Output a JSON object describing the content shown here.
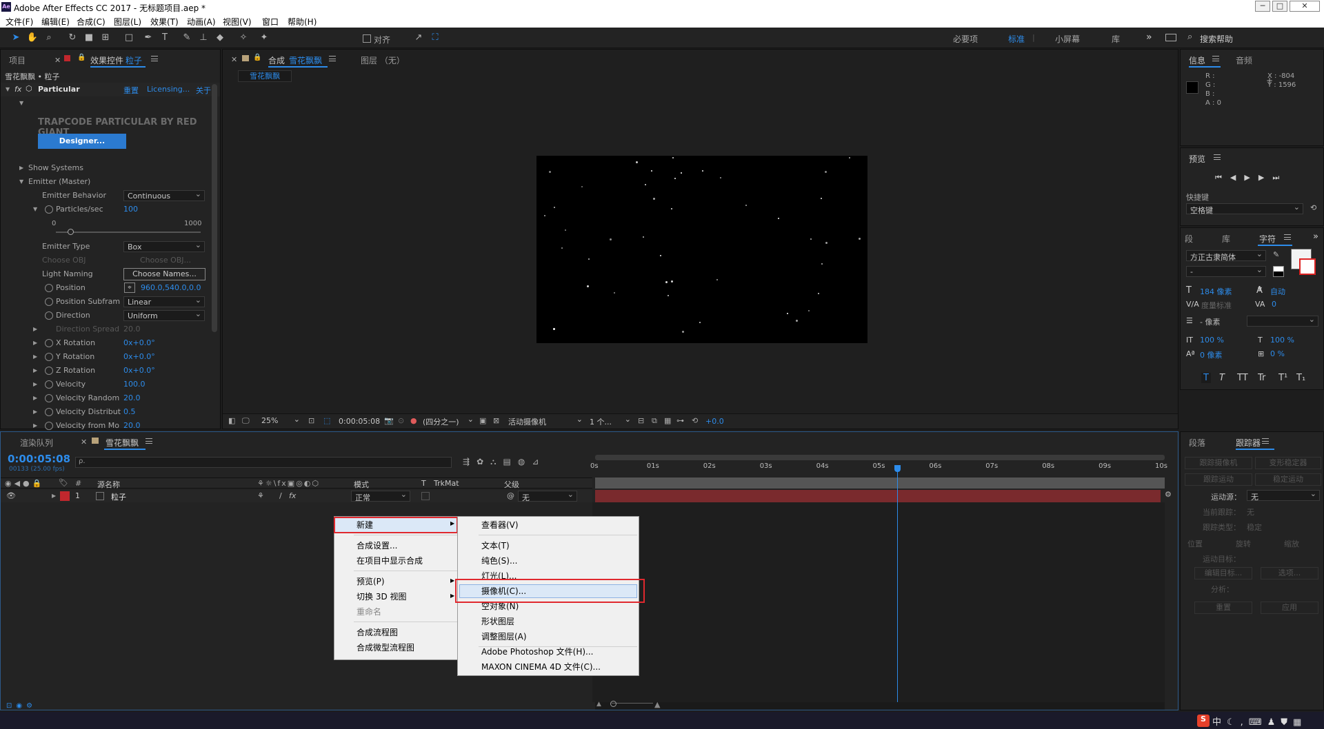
{
  "window": {
    "app_icon": "Ae",
    "title": "Adobe After Effects CC 2017 - 无标题项目.aep *",
    "controls": [
      "─",
      "□",
      "✕"
    ]
  },
  "menubar": [
    "文件(F)",
    "编辑(E)",
    "合成(C)",
    "图层(L)",
    "效果(T)",
    "动画(A)",
    "视图(V)",
    "窗口",
    "帮助(H)"
  ],
  "toolbar": {
    "align_label": "对齐",
    "workspaces": [
      "必要项",
      "标准",
      "小屏幕",
      "库"
    ],
    "active_workspace": "标准",
    "search_placeholder": "搜索帮助"
  },
  "left_panel": {
    "tabs": {
      "project": "项目",
      "effect_controls_prefix": "效果控件",
      "effect_layer": "粒子"
    },
    "breadcrumb": "雪花飘飘 • 粒子",
    "effect_name": "Particular",
    "reset": "重置",
    "licensing": "Licensing...",
    "about": "关于",
    "banner": "TRAPCODE PARTICULAR BY RED GIANT",
    "designer_btn": "Designer...",
    "show_systems": "Show Systems",
    "emitter": "Emitter (Master)",
    "emitter_behavior_label": "Emitter Behavior",
    "emitter_behavior": "Continuous",
    "particles_label": "Particles/sec",
    "particles_value": "100",
    "slider_min": "0",
    "slider_max": "1000",
    "slider_value": 100,
    "emitter_type_label": "Emitter Type",
    "emitter_type": "Box",
    "choose_obj_label": "Choose OBJ",
    "choose_obj_btn": "Choose OBJ...",
    "light_naming_label": "Light Naming",
    "choose_names_btn": "Choose Names...",
    "position_label": "Position",
    "position_value": "960.0,540.0,0.0",
    "position_subframe_label": "Position Subfram",
    "position_subframe": "Linear",
    "direction_label": "Direction",
    "direction": "Uniform",
    "direction_spread_label": "Direction Spread",
    "direction_spread": "20.0",
    "xrot_label": "X Rotation",
    "xrot": "0x+0.0°",
    "yrot_label": "Y Rotation",
    "yrot": "0x+0.0°",
    "zrot_label": "Z Rotation",
    "zrot": "0x+0.0°",
    "velocity_label": "Velocity",
    "velocity": "100.0",
    "vrand_label": "Velocity Random",
    "vrand": "20.0",
    "vdist_label": "Velocity Distribut",
    "vdist": "0.5",
    "vfrom_label": "Velocity from Mo",
    "vfrom": "20.0"
  },
  "comp_panel": {
    "tab_prefix": "合成",
    "comp_name": "雪花飘飘",
    "layer_tab": "图层 （无）",
    "subtab": "雪花飘飘",
    "zoom": "25%",
    "timecode": "0:00:05:08",
    "resolution": "(四分之一)",
    "camera": "活动摄像机",
    "views": "1 个...",
    "exposure": "+0.0"
  },
  "right_panel": {
    "info_tab": "信息",
    "audio_tab": "音频",
    "rgba": [
      "R :",
      "G :",
      "B :",
      "A : 0"
    ],
    "xy": [
      "X : -804",
      "Y : 1596"
    ],
    "preview_tab": "预览",
    "shortcut_label": "快捷键",
    "shortcut_value": "空格键",
    "para_tab": "段",
    "lib_tab": "库",
    "char_tab": "字符",
    "font": "方正古隶简体",
    "style": "-",
    "size": "184 像素",
    "leading": "自动",
    "tracking_label": "度量标准",
    "tracking": "0",
    "stroke": "- 像素",
    "vscale": "100 %",
    "hscale": "100 %",
    "baseline": "0 像素",
    "tsume": "0 %",
    "styles": [
      "T",
      "T",
      "TT",
      "Tr",
      "T¹",
      "T₁"
    ],
    "tracker_tabs": [
      "段落",
      "跟踪器"
    ],
    "track_camera": "跟踪摄像机",
    "warp_stab": "变形稳定器",
    "track_motion": "跟踪运动",
    "stabilize": "稳定运动",
    "motion_source_label": "运动源：",
    "motion_source": "无",
    "current_track_label": "当前跟踪：",
    "current_track": "无",
    "track_type_label": "跟踪类型：",
    "track_type": "稳定",
    "chk": [
      "位置",
      "旋转",
      "缩放"
    ],
    "motion_target_label": "运动目标：",
    "edit_target": "编辑目标...",
    "options": "选项...",
    "analyze": "分析：",
    "reset": "重置",
    "apply": "应用"
  },
  "timeline": {
    "render_tab": "渲染队列",
    "comp_tab": "雪花飘飘",
    "timecode": "0:00:05:08",
    "frames": "00133 (25.00 fps)",
    "search_placeholder": "ρ.",
    "col_name": "源名称",
    "col_mode": "模式",
    "col_t": "T",
    "col_trkmat": "TrkMat",
    "col_parent": "父级",
    "layer_num": "1",
    "layer_name": "粒子",
    "layer_mode": "正常",
    "layer_parent": "无",
    "ticks": [
      "0s",
      "01s",
      "02s",
      "03s",
      "04s",
      "05s",
      "06s",
      "07s",
      "08s",
      "09s",
      "10s"
    ],
    "playhead_sec": 5.32,
    "duration_sec": 10
  },
  "context_menu": {
    "items": [
      "新建",
      "合成设置...",
      "在项目中显示合成",
      "预览(P)",
      "切换 3D 视图",
      "重命名",
      "合成流程图",
      "合成微型流程图"
    ],
    "submenu": [
      "查看器(V)",
      "文本(T)",
      "纯色(S)...",
      "灯光(L)...",
      "摄像机(C)...",
      "空对象(N)",
      "形状图层",
      "调整图层(A)",
      "Adobe Photoshop 文件(H)...",
      "MAXON CINEMA 4D 文件(C)..."
    ]
  },
  "colors": {
    "accent": "#2d8ceb",
    "layer_label": "#c1272d",
    "highlight_box": "#e0282e"
  }
}
